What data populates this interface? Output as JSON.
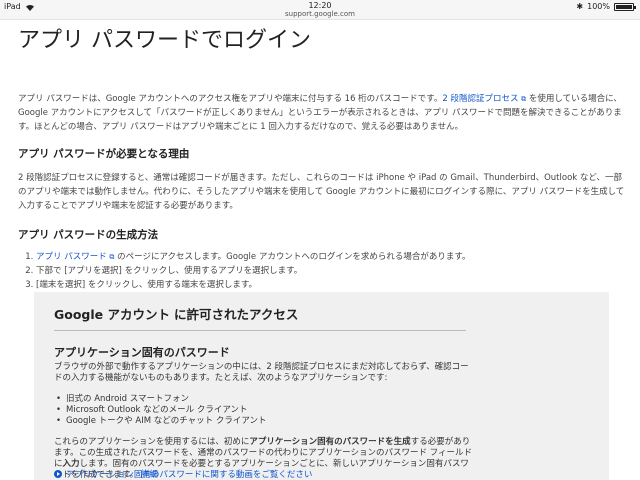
{
  "status_bar": {
    "device": "iPad",
    "time": "12:20",
    "url": "support.google.com",
    "battery": "100%"
  },
  "page": {
    "title": "アプリ パスワードでログイン",
    "intro": {
      "part1": "アプリ パスワードは、Google アカウントへのアクセス権をアプリや端末に付与する 16 桁のパスコードです。",
      "link": "2 段階認証プロセス",
      "part2": "を使用している場合に、Google アカウントにアクセスして「パスワードが正しくありません」というエラーが表示されるときは、アプリ パスワードで問題を解決できることがあります。ほとんどの場合、アプリ パスワードはアプリや端末ごとに 1 回入力するだけなので、覚える必要はありません。"
    },
    "reason": {
      "heading": "アプリ パスワードが必要となる理由",
      "text": "2 段階認証プロセスに登録すると、通常は確認コードが届きます。ただし、これらのコードは iPhone や iPad の Gmail、Thunderbird、Outlook など、一部のアプリや端末では動作しません。代わりに、そうしたアプリや端末を使用して Google アカウントに最初にログインする際に、アプリ パスワードを生成して入力することでアプリや端末を認証する必要があります。"
    },
    "generate": {
      "heading": "アプリ パスワードの生成方法",
      "step1_link": "アプリ パスワード",
      "step1_rest": "のページにアクセスします。Google アカウントへのログインを求められる場合があります。",
      "step2_pre": "下部で",
      "step2_bold": "[アプリを選択]",
      "step2_post": "をクリックし、使用するアプリを選択します。",
      "step3_bold": "[端末を選択]",
      "step3_post": "をクリックし、使用する端末を選択します。"
    }
  },
  "panel": {
    "title_pre": "Google アカウント",
    "title_post": "に許可されたアクセス",
    "subheading": "アプリケーション固有のパスワード",
    "para1": "ブラウザの外部で動作するアプリケーションの中には、2 段階認証プロセスにまだ対応しておらず、確認コードの入力する機能がないものもあります。たとえば、次のようなアプリケーションです:",
    "bullets": [
      "旧式の Android スマートフォン",
      "Microsoft Outlook などのメール クライアント",
      "Google トークや AIM などのチャット クライアント"
    ],
    "para2_a": "これらのアプリケーションを使用するには、初めに",
    "para2_b": "アプリケーション固有のパスワードを生成",
    "para2_c": "する必要があります。この生成されたパスワードを、通常のパスワードの代わりにアプリケーションのパスワード フィールドに",
    "para2_d": "入力",
    "para2_e": "します。固有のパスワードを必要とするアプリケーションごとに、新しいアプリケーション固有パスワードを作成できます。",
    "para2_link": "詳細",
    "video_link": "アプリケーション固有のパスワードに関する動画をご覧ください"
  }
}
